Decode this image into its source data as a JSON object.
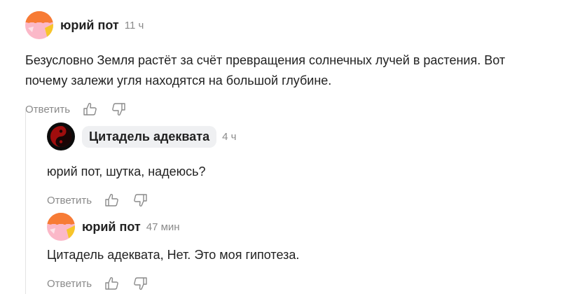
{
  "comments": [
    {
      "author": "юрий пот",
      "time": "11 ч",
      "text_lines": [
        "Безусловно Земля растёт за счёт превращения солнечных лучей в растения. Вот",
        "почему залежи угля находятся на большой глубине."
      ],
      "reply_label": "Ответить"
    },
    {
      "author": "Цитадель адеквата",
      "time": "4 ч",
      "text_lines": [
        "юрий пот, шутка, надеюсь?"
      ],
      "reply_label": "Ответить"
    },
    {
      "author": "юрий пот",
      "time": "47 мин",
      "text_lines": [
        "Цитадель адеквата, Нет. Это моя гипотеза."
      ],
      "reply_label": "Ответить"
    }
  ],
  "icons": {
    "like": "thumbs-up-icon",
    "dislike": "thumbs-down-icon"
  },
  "colors": {
    "muted": "#8a8a8a",
    "text": "#222222",
    "pill_bg": "#eff0f2",
    "thread_line": "#e3e3e3"
  }
}
